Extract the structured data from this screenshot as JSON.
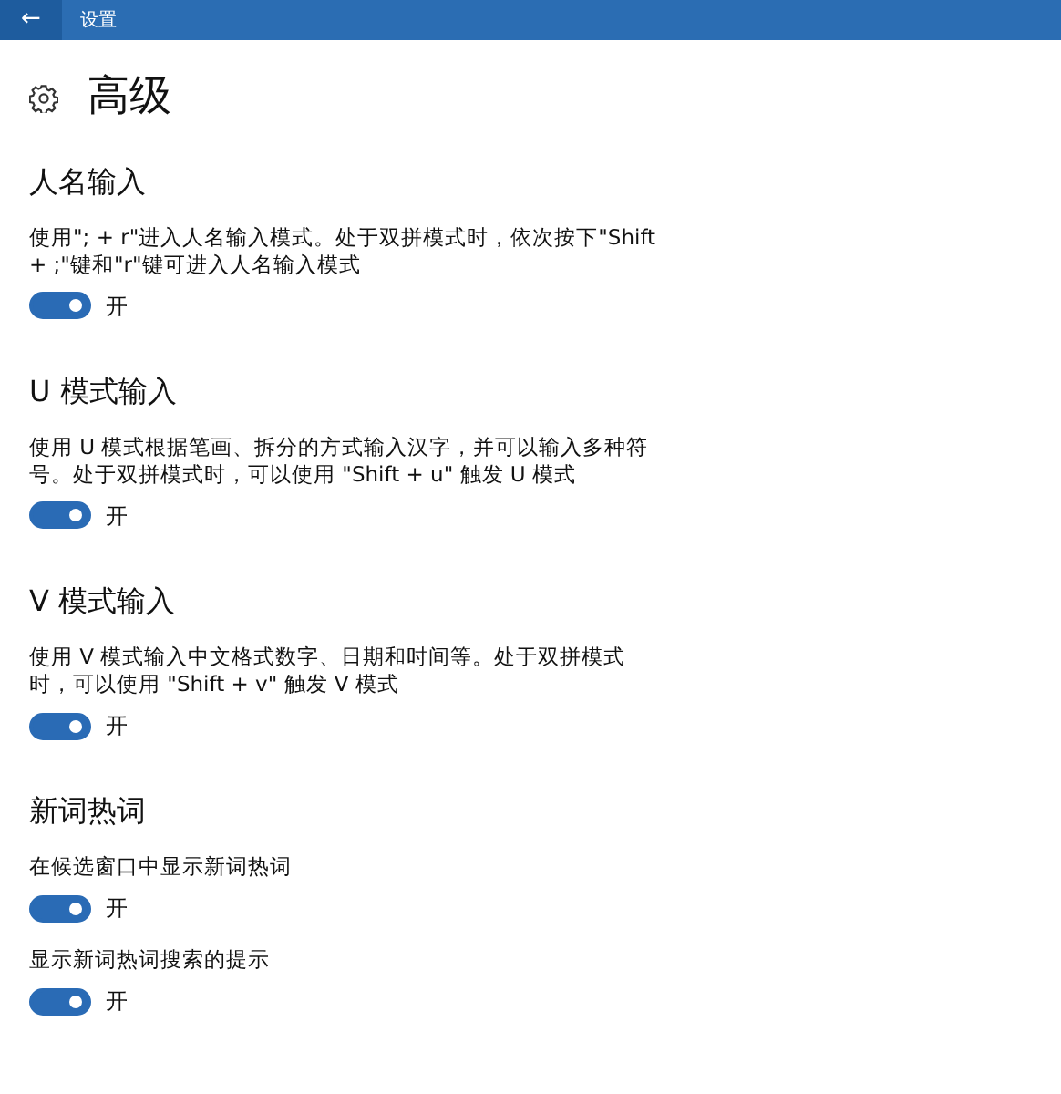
{
  "title_bar": {
    "back": "←",
    "title": "设置"
  },
  "page": {
    "title": "高级"
  },
  "sections": [
    {
      "heading": "人名输入",
      "settings": [
        {
          "description": "使用\"; + r\"进入人名输入模式。处于双拼模式时，依次按下\"Shift + ;\"键和\"r\"键可进入人名输入模式",
          "on": true,
          "state_label": "开"
        }
      ]
    },
    {
      "heading": "U 模式输入",
      "settings": [
        {
          "description": "使用 U 模式根据笔画、拆分的方式输入汉字，并可以输入多种符号。处于双拼模式时，可以使用 \"Shift + u\" 触发 U 模式",
          "on": true,
          "state_label": "开"
        }
      ]
    },
    {
      "heading": "V 模式输入",
      "settings": [
        {
          "description": "使用 V 模式输入中文格式数字、日期和时间等。处于双拼模式时，可以使用 \"Shift + v\" 触发 V 模式",
          "on": true,
          "state_label": "开"
        }
      ]
    },
    {
      "heading": "新词热词",
      "settings": [
        {
          "description": "在候选窗口中显示新词热词",
          "on": true,
          "state_label": "开"
        },
        {
          "description": "显示新词热词搜索的提示",
          "on": true,
          "state_label": "开"
        }
      ]
    }
  ]
}
